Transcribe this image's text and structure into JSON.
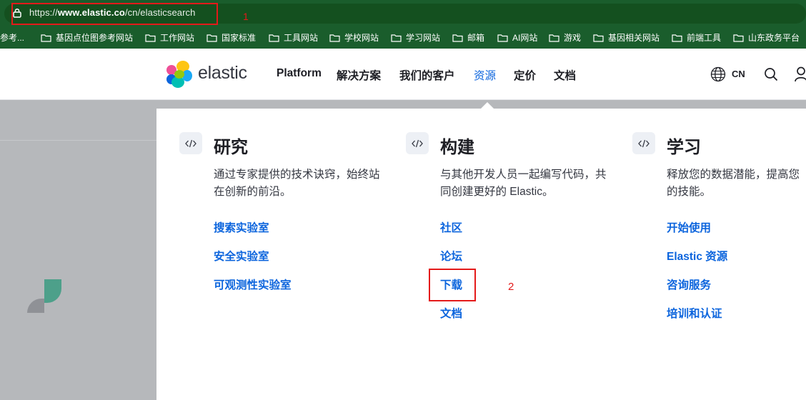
{
  "browser": {
    "url_prefix": "https://",
    "url_domain": "www.elastic.co",
    "url_path": "/cn/elasticsearch",
    "annotation_1": "1",
    "annotation_2": "2"
  },
  "bookmarks": [
    {
      "label": "参考..."
    },
    {
      "label": "基因点位图参考网站"
    },
    {
      "label": "工作网站"
    },
    {
      "label": "国家标准"
    },
    {
      "label": "工具网站"
    },
    {
      "label": "学校网站"
    },
    {
      "label": "学习网站"
    },
    {
      "label": "邮箱"
    },
    {
      "label": "AI网站"
    },
    {
      "label": "游戏"
    },
    {
      "label": "基因相关网站"
    },
    {
      "label": "前端工具"
    },
    {
      "label": "山东政务平台"
    }
  ],
  "header": {
    "logo_text": "elastic",
    "nav": [
      "Platform",
      "解决方案",
      "我们的客户",
      "资源",
      "定价",
      "文档"
    ],
    "active_nav": "资源",
    "lang": "CN"
  },
  "menu": {
    "columns": [
      {
        "title": "研究",
        "description": "通过专家提供的技术诀窍，始终站在创新的前沿。",
        "links": [
          "搜索实验室",
          "安全实验室",
          "可观测性实验室"
        ]
      },
      {
        "title": "构建",
        "description": "与其他开发人员一起编写代码，共同创建更好的 Elastic。",
        "links": [
          "社区",
          "论坛",
          "下载",
          "文档"
        ]
      },
      {
        "title": "学习",
        "description": "释放您的数据潜能，提高您的技能。",
        "links": [
          "开始使用",
          "Elastic 资源",
          "咨询服务",
          "培训和认证"
        ]
      }
    ]
  },
  "colors": {
    "browser_bar": "#1a5d2c",
    "link_blue": "#0b64dd",
    "annotation_red": "#e41a1a"
  }
}
